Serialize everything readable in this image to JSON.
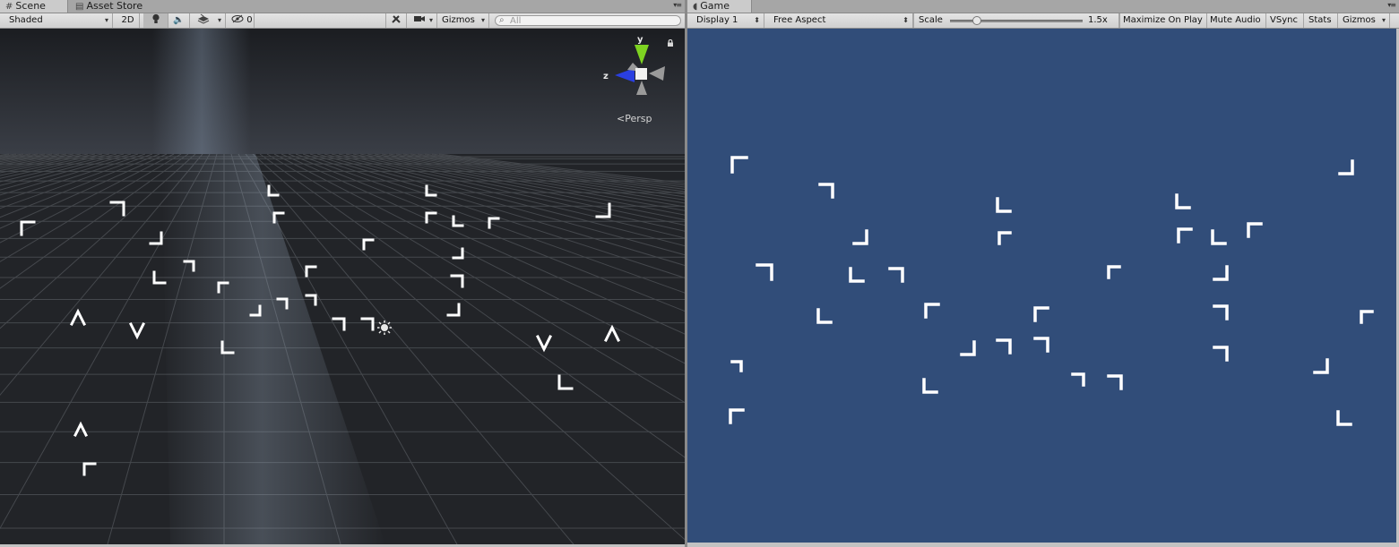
{
  "scene_tab": {
    "tabs": [
      {
        "label": "Scene",
        "icon": "scene-icon"
      },
      {
        "label": "Asset Store",
        "icon": "asset-store-icon"
      }
    ]
  },
  "scene_toolbar": {
    "shading_mode": "Shaded",
    "mode_2d": "2D",
    "hidden_count": "0",
    "gizmos": "Gizmos",
    "search_placeholder": "All"
  },
  "scene_view": {
    "orientation_axes": {
      "y": "y",
      "z": "z"
    },
    "projection": "Persp",
    "colors": {
      "sky_top": "#1b1d21",
      "sky_bottom": "#3c4048",
      "ground": "#222428",
      "grid": "#4a4d52",
      "axis_y": "#7ed321",
      "axis_z": "#2a3fe0"
    }
  },
  "game_tab": {
    "label": "Game",
    "icon": "game-controller-icon"
  },
  "game_toolbar": {
    "display": "Display 1",
    "aspect": "Free Aspect",
    "scale_label": "Scale",
    "scale_value": "1.5x",
    "scale_fraction": 0.2,
    "maximize_on_play": "Maximize On Play",
    "mute_audio": "Mute Audio",
    "vsync": "VSync",
    "stats": "Stats",
    "gizmos": "Gizmos"
  },
  "game_view": {
    "background_color": "#314d79"
  }
}
